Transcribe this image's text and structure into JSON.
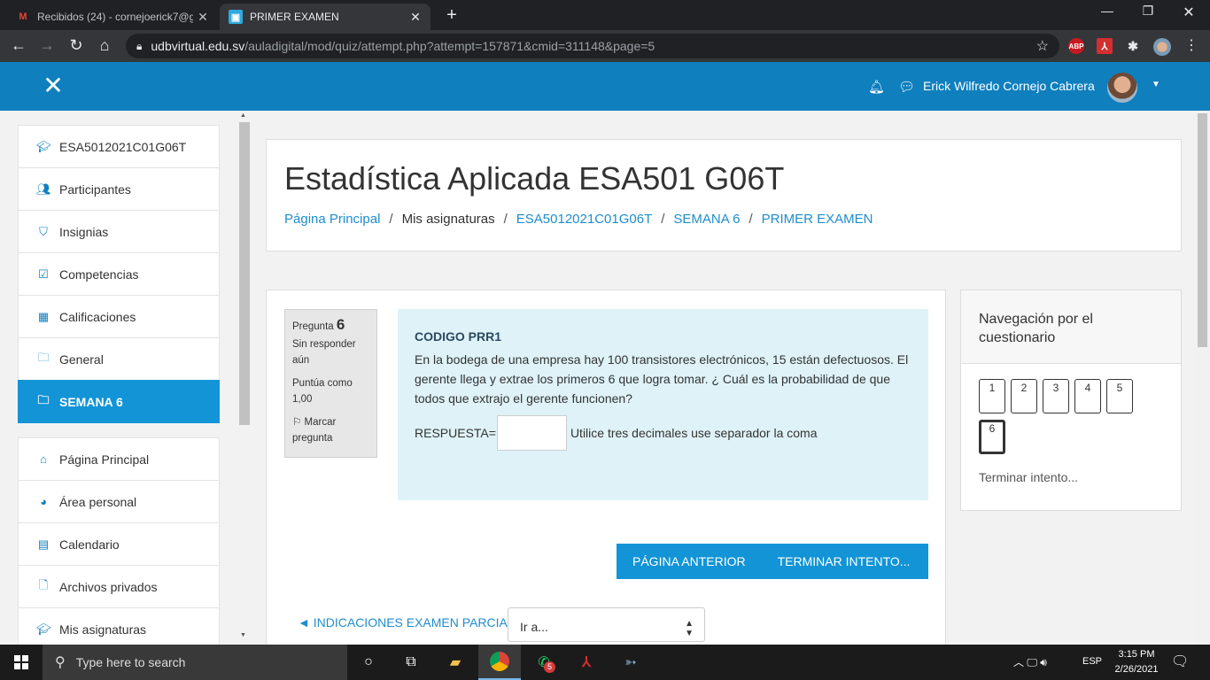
{
  "browser": {
    "tabs": [
      {
        "title": "Recibidos (24) - cornejoerick7@g",
        "favicon": "gmail-icon"
      },
      {
        "title": "PRIMER EXAMEN",
        "favicon": "moodle-icon",
        "active": true
      }
    ],
    "url_host": "udbvirtual.edu.sv",
    "url_path": "/auladigital/mod/quiz/attempt.php?attempt=157871&cmid=311148&page=5",
    "extensions": [
      "ABP"
    ]
  },
  "navbar": {
    "user_name": "Erick Wilfredo Cornejo Cabrera",
    "color": "#0f7fbe"
  },
  "drawer": {
    "course_items": [
      {
        "label": "ESA5012021C01G06T",
        "icon": "graduation-cap-icon"
      },
      {
        "label": "Participantes",
        "icon": "users-icon"
      },
      {
        "label": "Insignias",
        "icon": "shield-icon"
      },
      {
        "label": "Competencias",
        "icon": "checkbox-icon"
      },
      {
        "label": "Calificaciones",
        "icon": "table-icon"
      },
      {
        "label": "General",
        "icon": "folder-icon"
      },
      {
        "label": "SEMANA 6",
        "icon": "folder-icon",
        "active": true
      }
    ],
    "site_items": [
      {
        "label": "Página Principal",
        "icon": "home-icon"
      },
      {
        "label": "Área personal",
        "icon": "dashboard-icon"
      },
      {
        "label": "Calendario",
        "icon": "calendar-icon"
      },
      {
        "label": "Archivos privados",
        "icon": "file-icon"
      },
      {
        "label": "Mis asignaturas",
        "icon": "graduation-cap-icon"
      }
    ]
  },
  "header": {
    "title": "Estadística Aplicada ESA501 G06T",
    "breadcrumb": [
      "Página Principal",
      "Mis asignaturas",
      "ESA5012021C01G06T",
      "SEMANA 6",
      "PRIMER EXAMEN"
    ]
  },
  "question": {
    "label": "Pregunta",
    "number": "6",
    "state": "Sin responder aún",
    "marks": "Puntúa como 1,00",
    "flag": "Marcar pregunta",
    "code": "CODIGO PRR1",
    "text": "En la bodega de una empresa hay 100 transistores electrónicos, 15 están defectuosos. El gerente llega y extrae los primeros 6 que logra tomar. ¿ Cuál es la probabilidad de que todos que extrajo el gerente funcionen?",
    "answer_label": "RESPUESTA=",
    "answer_value": "",
    "answer_hint": "Utilice tres decimales use separador la coma"
  },
  "buttons": {
    "previous": "PÁGINA ANTERIOR",
    "finish": "TERMINAR INTENTO..."
  },
  "footer_nav": {
    "prev_link": "◄ INDICACIONES EXAMEN PARCIA",
    "jump_label": "Ir a..."
  },
  "quiz_nav": {
    "title": "Navegación por el cuestionario",
    "pages": [
      "1",
      "2",
      "3",
      "4",
      "5",
      "6"
    ],
    "current": "6",
    "finish_link": "Terminar intento..."
  },
  "taskbar": {
    "search_placeholder": "Type here to search",
    "whatsapp_badge": "5",
    "language": "ESP",
    "time": "3:15 PM",
    "date": "2/26/2021"
  }
}
